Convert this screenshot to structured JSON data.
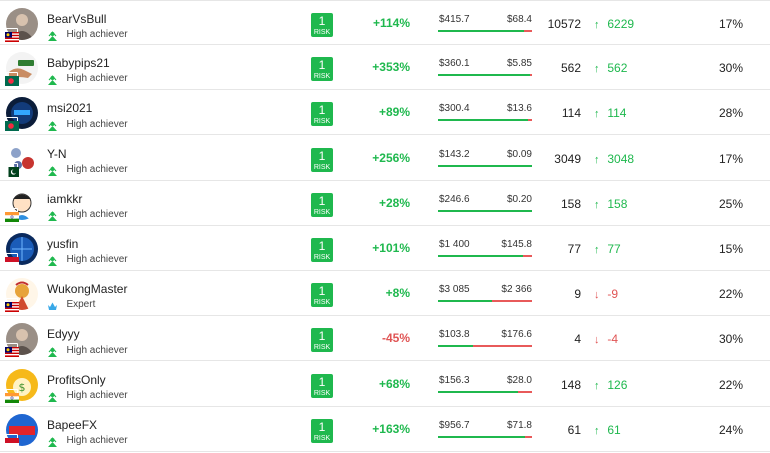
{
  "colors": {
    "green": "#1fb84e",
    "red": "#e05454",
    "risk_bg": "#1fb84e"
  },
  "badge_icons": {
    "high_achiever": "green-star-person-icon",
    "expert": "blue-crown-person-icon"
  },
  "rows": [
    {
      "name": "BearVsBull",
      "badge": "High achiever",
      "badge_type": "high",
      "flag": "malaysia-flag",
      "avatar": "avatar-photo-icon",
      "risk": "1",
      "risk_label": "RISK",
      "gain": "+114%",
      "gain_dir": "pos",
      "equity": "$415.7",
      "profit": "$68.4",
      "eq_fraction": 0.92,
      "copiers": "10572",
      "change": "6229",
      "change_dir": "up",
      "percent": "17%"
    },
    {
      "name": "Babypips21",
      "badge": "High achiever",
      "badge_type": "high",
      "flag": "bangladesh-flag",
      "avatar": "avatar-hand-money-icon",
      "risk": "1",
      "risk_label": "RISK",
      "gain": "+353%",
      "gain_dir": "pos",
      "equity": "$360.1",
      "profit": "$5.85",
      "eq_fraction": 0.98,
      "copiers": "562",
      "change": "562",
      "change_dir": "up",
      "percent": "30%"
    },
    {
      "name": "msi2021",
      "badge": "High achiever",
      "badge_type": "high",
      "flag": "bangladesh-flag",
      "avatar": "avatar-blue-logo-icon",
      "risk": "1",
      "risk_label": "RISK",
      "gain": "+89%",
      "gain_dir": "pos",
      "equity": "$300.4",
      "profit": "$13.6",
      "eq_fraction": 0.96,
      "copiers": "114",
      "change": "114",
      "change_dir": "up",
      "percent": "28%"
    },
    {
      "name": "Y-N",
      "badge": "High achiever",
      "badge_type": "high",
      "flag": "pakistan-flag",
      "avatar": "avatar-coins-icon",
      "risk": "1",
      "risk_label": "RISK",
      "gain": "+256%",
      "gain_dir": "pos",
      "equity": "$143.2",
      "profit": "$0.09",
      "eq_fraction": 1.0,
      "copiers": "3049",
      "change": "3048",
      "change_dir": "up",
      "percent": "17%"
    },
    {
      "name": "iamkkr",
      "badge": "High achiever",
      "badge_type": "high",
      "flag": "india-flag",
      "avatar": "avatar-cartoon-icon",
      "risk": "1",
      "risk_label": "RISK",
      "gain": "+28%",
      "gain_dir": "pos",
      "equity": "$246.6",
      "profit": "$0.20",
      "eq_fraction": 1.0,
      "copiers": "158",
      "change": "158",
      "change_dir": "up",
      "percent": "25%"
    },
    {
      "name": "yusfin",
      "badge": "High achiever",
      "badge_type": "high",
      "flag": "indonesia-flag",
      "avatar": "avatar-globe-icon",
      "risk": "1",
      "risk_label": "RISK",
      "gain": "+101%",
      "gain_dir": "pos",
      "equity": "$1 400",
      "profit": "$145.8",
      "eq_fraction": 0.9,
      "copiers": "77",
      "change": "77",
      "change_dir": "up",
      "percent": "15%"
    },
    {
      "name": "WukongMaster",
      "badge": "Expert",
      "badge_type": "expert",
      "flag": "malaysia-flag",
      "avatar": "avatar-monkey-king-icon",
      "risk": "1",
      "risk_label": "RISK",
      "gain": "+8%",
      "gain_dir": "pos",
      "equity": "$3 085",
      "profit": "$2 366",
      "eq_fraction": 0.57,
      "copiers": "9",
      "change": "-9",
      "change_dir": "down",
      "percent": "22%"
    },
    {
      "name": "Edyyy",
      "badge": "High achiever",
      "badge_type": "high",
      "flag": "malaysia-flag",
      "avatar": "avatar-photo-icon",
      "risk": "1",
      "risk_label": "RISK",
      "gain": "-45%",
      "gain_dir": "neg",
      "equity": "$103.8",
      "profit": "$176.6",
      "eq_fraction": 0.37,
      "copiers": "4",
      "change": "-4",
      "change_dir": "down",
      "percent": "30%"
    },
    {
      "name": "ProfitsOnly",
      "badge": "High achiever",
      "badge_type": "high",
      "flag": "india-flag",
      "avatar": "avatar-money-bag-icon",
      "risk": "1",
      "risk_label": "RISK",
      "gain": "+68%",
      "gain_dir": "pos",
      "equity": "$156.3",
      "profit": "$28.0",
      "eq_fraction": 0.85,
      "copiers": "148",
      "change": "126",
      "change_dir": "up",
      "percent": "22%"
    },
    {
      "name": "BapeeFX",
      "badge": "High achiever",
      "badge_type": "high",
      "flag": "indonesia-flag",
      "avatar": "avatar-bapeefx-logo-icon",
      "risk": "1",
      "risk_label": "RISK",
      "gain": "+163%",
      "gain_dir": "pos",
      "equity": "$956.7",
      "profit": "$71.8",
      "eq_fraction": 0.93,
      "copiers": "61",
      "change": "61",
      "change_dir": "up",
      "percent": "24%"
    }
  ]
}
